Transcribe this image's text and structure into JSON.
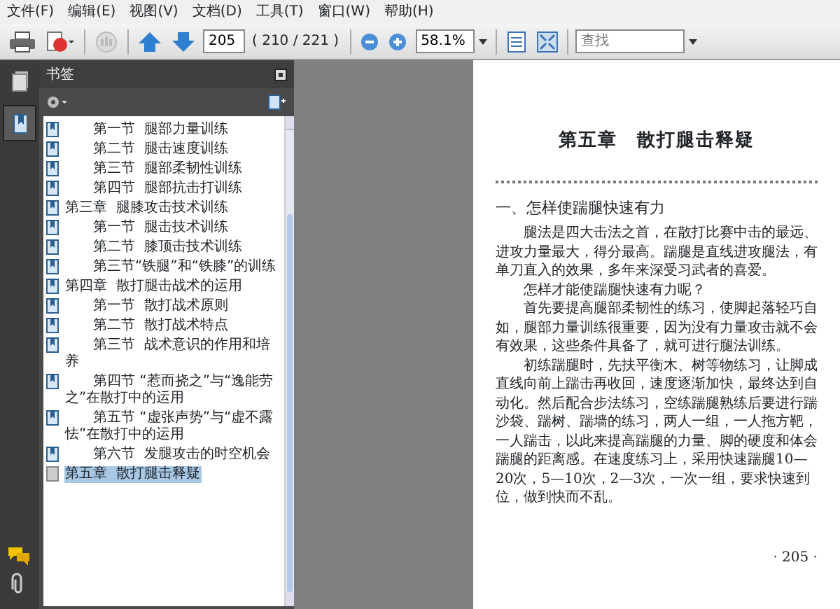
{
  "menu": [
    "文件(F)",
    "编辑(E)",
    "视图(V)",
    "文档(D)",
    "工具(T)",
    "窗口(W)",
    "帮助(H)"
  ],
  "toolbar": {
    "page_field": "205",
    "page_count": "( 210 / 221 )",
    "zoom_field": "58.1%",
    "search": {
      "placeholder": "查找"
    }
  },
  "side_rail": [
    {
      "kind": "pages",
      "selected": false
    },
    {
      "kind": "bookmarks",
      "selected": true
    }
  ],
  "bookmarks_panel": {
    "title": "书签",
    "items": [
      {
        "label": "　　第一节  腿部力量训练",
        "selected": false
      },
      {
        "label": "　　第二节  腿击速度训练",
        "selected": false
      },
      {
        "label": "　　第三节  腿部柔韧性训练",
        "selected": false
      },
      {
        "label": "　　第四节  腿部抗击打训练",
        "selected": false
      },
      {
        "label": "第三章  腿膝攻击技术训练",
        "selected": false
      },
      {
        "label": "　　第一节  腿击技术训练",
        "selected": false
      },
      {
        "label": "　　第二节  膝顶击技术训练",
        "selected": false
      },
      {
        "label": "　　第三节“铁腿”和“铁膝”的训练",
        "selected": false
      },
      {
        "label": "第四章  散打腿击战术的运用",
        "selected": false
      },
      {
        "label": "　　第一节  散打战术原则",
        "selected": false
      },
      {
        "label": "　　第二节  散打战术特点",
        "selected": false
      },
      {
        "label": "　　第三节  战术意识的作用和培养",
        "selected": false
      },
      {
        "label": "　　第四节 “惹而挠之”与“逸能劳之”在散打中的运用",
        "selected": false
      },
      {
        "label": "　　第五节 “虚张声势”与“虚不露怯”在散打中的运用",
        "selected": false
      },
      {
        "label": "　　第六节  发腿攻击的时空机会",
        "selected": false
      },
      {
        "label": "第五章  散打腿击释疑",
        "selected": true
      }
    ]
  },
  "page": {
    "chapter_title": "第五章　散打腿击释疑",
    "section_heading": "一、怎样使踹腿快速有力",
    "paragraphs": [
      "腿法是四大击法之首，在散打比赛中击的最远、进攻力量最大，得分最高。踹腿是直线进攻腿法，有单刀直入的效果，多年来深受习武者的喜爱。",
      "怎样才能使踹腿快速有力呢？",
      "首先要提高腿部柔韧性的练习，使脚起落轻巧自如，腿部力量训练很重要，因为没有力量攻击就不会有效果，这些条件具备了，就可进行腿法训练。",
      "初练踹腿时，先扶平衡木、树等物练习，让脚成直线向前上踹击再收回，速度逐渐加快，最终达到自动化。然后配合步法练习，空练踹腿熟练后要进行踹沙袋、踹树、踹墙的练习，两人一组，一人拖方靶，一人踹击，以此来提高踹腿的力量、脚的硬度和体会踹腿的距离感。在速度练习上，采用快速踹腿10—20次，5—10次，2—3次，一次一组，要求快速到位，做到快而不乱。"
    ],
    "page_number": "· 205 ·"
  }
}
